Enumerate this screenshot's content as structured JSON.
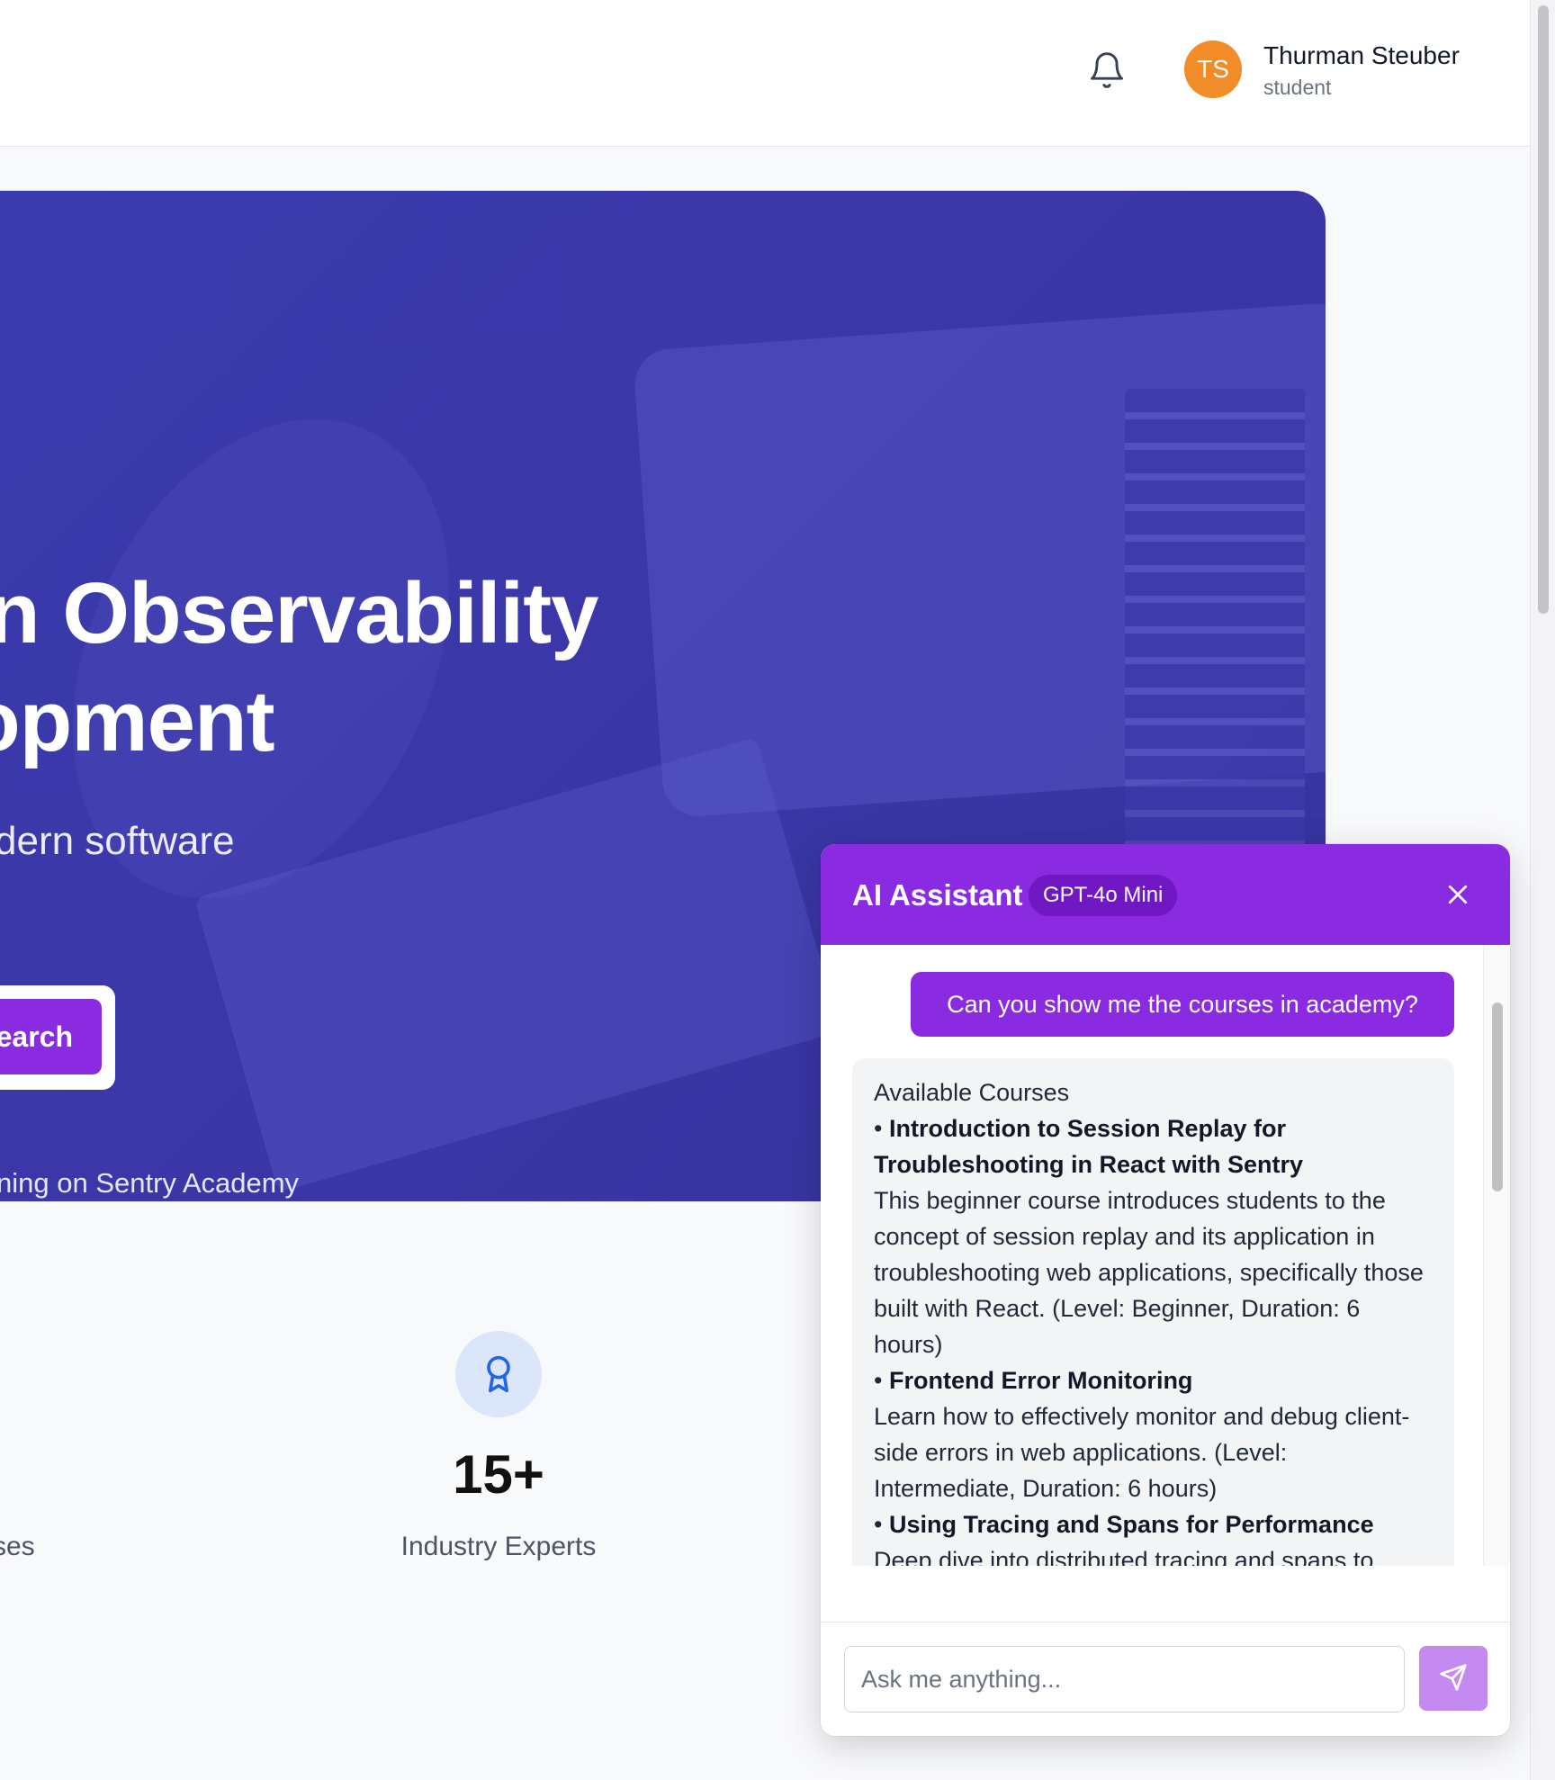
{
  "header": {
    "user": {
      "initials": "TS",
      "name": "Thurman Steuber",
      "role": "student"
    },
    "icons": [
      "bell-icon"
    ]
  },
  "hero": {
    "title_line1": "n Observability",
    "title_line2": "opment",
    "subtitle": "dern software",
    "search_button": "earch",
    "footnote": "ning on Sentry Academy"
  },
  "stats": {
    "left_label": "ses",
    "expert": {
      "icon": "award-icon",
      "value": "15+",
      "label": "Industry Experts"
    }
  },
  "chat": {
    "title": "AI Assistant",
    "model_badge": "GPT-4o Mini",
    "user_message": "Can you show me the courses in academy?",
    "bot": {
      "heading": "Available Courses",
      "courses": [
        {
          "bullet": "• ",
          "title": "Introduction to Session Replay for Troubleshooting in React with Sentry",
          "description": "This beginner course introduces students to the concept of session replay and its application in troubleshooting web applications, specifically those built with React. (Level: Beginner, Duration: 6 hours)"
        },
        {
          "bullet": "• ",
          "title": "Frontend Error Monitoring",
          "description": "Learn how to effectively monitor and debug client-side errors in web applications. (Level: Intermediate, Duration: 6 hours)"
        },
        {
          "bullet": "• ",
          "title": "Using Tracing and Spans for Performance",
          "description": "Deep dive into distributed tracing and spans to understand and optimize application"
        }
      ]
    },
    "input_placeholder": "Ask me anything...",
    "colors": {
      "accent": "#8a2be2",
      "badge": "#7017c4",
      "send_disabled": "#c58af2"
    }
  }
}
